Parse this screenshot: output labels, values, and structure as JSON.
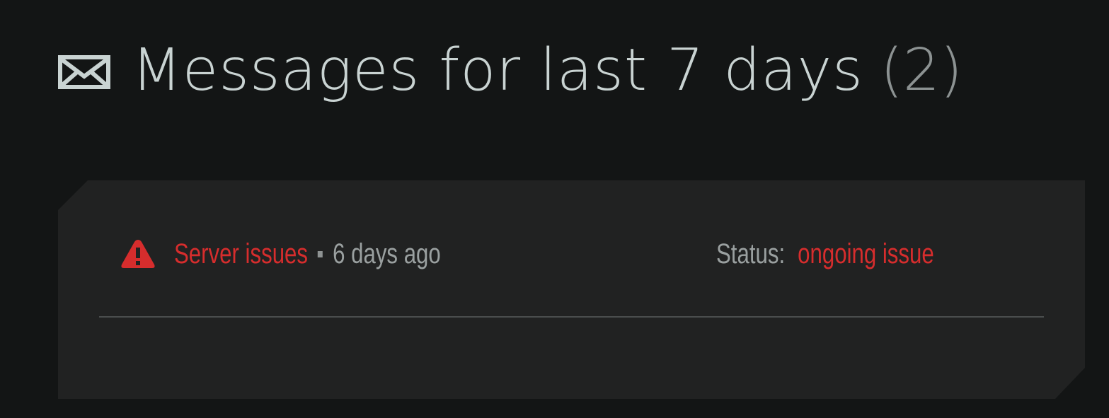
{
  "header": {
    "icon": "envelope-icon",
    "title": "Messages for last 7 days",
    "count": "(2)"
  },
  "messages": [
    {
      "icon": "warning-icon",
      "subject": "Server issues",
      "age": "6 days ago",
      "status_label": "Status:",
      "status_value": "ongoing issue"
    }
  ],
  "colors": {
    "background": "#131515",
    "card": "#212222",
    "title": "#c9d3d2",
    "alert": "#d62d2d",
    "muted": "#9aa0a0"
  }
}
